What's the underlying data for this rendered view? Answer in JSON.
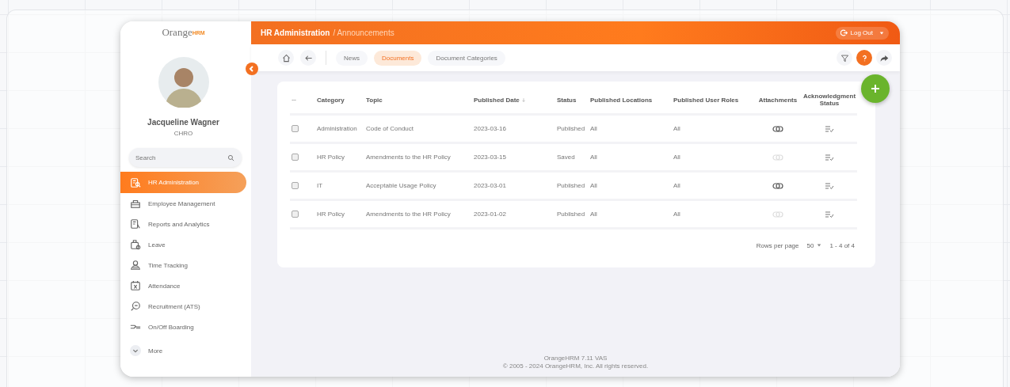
{
  "logo": {
    "text": "Orange",
    "suffix": "HRM"
  },
  "user": {
    "name": "Jacqueline Wagner",
    "role": "CHRO"
  },
  "search": {
    "placeholder": "Search"
  },
  "nav": [
    {
      "label": "HR Administration",
      "selected": true
    },
    {
      "label": "Employee Management",
      "selected": false
    },
    {
      "label": "Reports and Analytics",
      "selected": false
    },
    {
      "label": "Leave",
      "selected": false
    },
    {
      "label": "Time Tracking",
      "selected": false
    },
    {
      "label": "Attendance",
      "selected": false
    },
    {
      "label": "Recruitment (ATS)",
      "selected": false
    },
    {
      "label": "On/Off Boarding",
      "selected": false
    }
  ],
  "more": {
    "label": "More"
  },
  "header": {
    "title": "HR Administration",
    "subtitle": "/ Announcements",
    "logout": "Log Out"
  },
  "tabs": [
    {
      "label": "News",
      "selected": false
    },
    {
      "label": "Documents",
      "selected": true
    },
    {
      "label": "Document Categories",
      "selected": false
    }
  ],
  "table": {
    "columns": [
      {
        "label": "Category",
        "sorted": false
      },
      {
        "label": "Topic",
        "sorted": false
      },
      {
        "label": "Published Date",
        "sorted": true
      },
      {
        "label": "Status",
        "sorted": false
      },
      {
        "label": "Published Locations",
        "sorted": false
      },
      {
        "label": "Published User Roles",
        "sorted": false
      },
      {
        "label": "Attachments",
        "sorted": false
      },
      {
        "label": "Acknowledgment Status",
        "sorted": false
      }
    ],
    "rows": [
      {
        "checked": false,
        "category": "Administration",
        "topic": "Code of Conduct",
        "date": "2023-03-16",
        "status": "Published",
        "locations": "All",
        "roles": "All",
        "attached": true
      },
      {
        "checked": false,
        "category": "HR Policy",
        "topic": "Amendments to the HR Policy",
        "date": "2023-03-15",
        "status": "Saved",
        "locations": "All",
        "roles": "All",
        "attached": false
      },
      {
        "checked": false,
        "category": "IT",
        "topic": "Acceptable Usage Policy",
        "date": "2023-03-01",
        "status": "Published",
        "locations": "All",
        "roles": "All",
        "attached": true
      },
      {
        "checked": false,
        "category": "HR Policy",
        "topic": "Amendments to the HR Policy",
        "date": "2023-01-02",
        "status": "Published",
        "locations": "All",
        "roles": "All",
        "attached": false
      }
    ]
  },
  "pagination": {
    "label": "Rows per page",
    "page_size": "50",
    "range": "1 - 4 of 4"
  },
  "footer": {
    "version": "OrangeHRM 7.11 VAS",
    "prefix": "© 2005 - 2024",
    "link": "OrangeHRM, Inc.",
    "suffix": "All rights reserved."
  }
}
